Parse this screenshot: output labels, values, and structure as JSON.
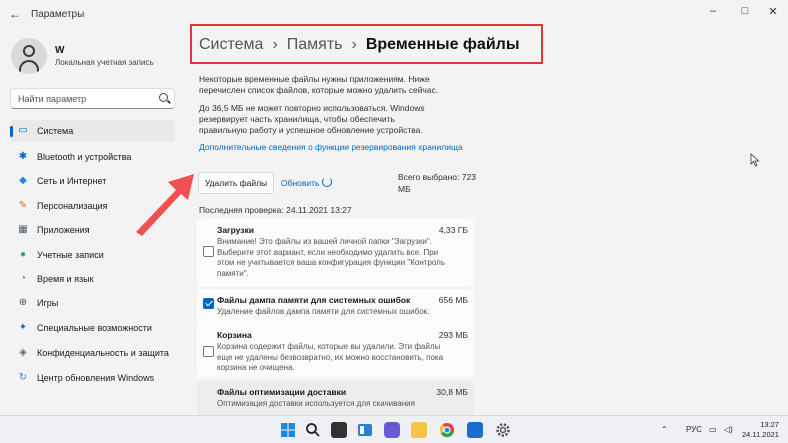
{
  "window": {
    "title": "Параметры",
    "back_icon": "←",
    "min_icon": "–",
    "max_icon": "□",
    "close_icon": "✕"
  },
  "user": {
    "name": "W",
    "account_type": "Локальная учетная запись"
  },
  "search": {
    "placeholder": "Найти параметр"
  },
  "sidebar": {
    "items": [
      {
        "label": "Система",
        "icon": "monitor-icon",
        "glyph": "▭",
        "color": "#0067c0",
        "active": true
      },
      {
        "label": "Bluetooth и устройства",
        "icon": "bluetooth-icon",
        "glyph": "✱",
        "color": "#0067c0"
      },
      {
        "label": "Сеть и Интернет",
        "icon": "wifi-icon",
        "glyph": "◆",
        "color": "#1e88e5"
      },
      {
        "label": "Персонализация",
        "icon": "brush-icon",
        "glyph": "✎",
        "color": "#c9743a"
      },
      {
        "label": "Приложения",
        "icon": "apps-icon",
        "glyph": "▦",
        "color": "#4a5a6a"
      },
      {
        "label": "Учетные записи",
        "icon": "accounts-icon",
        "glyph": "●",
        "color": "#2aa0a0"
      },
      {
        "label": "Время и язык",
        "icon": "globe-icon",
        "glyph": "◔",
        "color": "#1e88e5"
      },
      {
        "label": "Игры",
        "icon": "gamepad-icon",
        "glyph": "⊕",
        "color": "#555"
      },
      {
        "label": "Специальные возможности",
        "icon": "accessibility-icon",
        "glyph": "✦",
        "color": "#1e6fb8"
      },
      {
        "label": "Конфиденциальность и защита",
        "icon": "shield-icon",
        "glyph": "◈",
        "color": "#666"
      },
      {
        "label": "Центр обновления Windows",
        "icon": "update-icon",
        "glyph": "↻",
        "color": "#1e88e5"
      }
    ]
  },
  "breadcrumb": {
    "part1": "Система",
    "part2": "Память",
    "part3": "Временные файлы",
    "sep": "›",
    "highlight_color": "#e0363a"
  },
  "main": {
    "intro": "Некоторые временные файлы нужны приложениям. Ниже перечислен список файлов, которые можно удалить сейчас.",
    "reserve": "До 36,5 МБ не может повторно использоваться. Windows резервирует часть хранилища, чтобы обеспечить правильную работу и успешное обновление устройства.",
    "reserve_link": "Дополнительные сведения о функции резервирования хранилища",
    "delete_button": "Удалить файлы",
    "refresh_link": "Обновить",
    "total_selected": "Всего выбрано: 723 МБ",
    "last_scan": "Последняя проверка: 24.11.2021 13:27",
    "accent": "#0067c0"
  },
  "files": [
    {
      "title": "Загрузки",
      "size": "4,33 ГБ",
      "checked": false,
      "desc": "Внимание! Это файлы из вашей личной папки \"Загрузки\". Выберите этот вариант, если необходимо удалить все. При этом не учитывается ваша конфигурация функции \"Контроль памяти\"."
    },
    {
      "title": "Файлы дампа памяти для системных ошибок",
      "size": "656 МБ",
      "checked": true,
      "desc": "Удаление файлов дампа памяти для системных ошибок."
    },
    {
      "title": "Корзина",
      "size": "293 МБ",
      "checked": false,
      "desc": "Корзина содержит файлы, которые вы удалили. Эти файлы еще не удалены безвозвратно, их можно восстановить, пока корзина не очищена."
    },
    {
      "title": "Файлы оптимизации доставки",
      "size": "30,8 МБ",
      "checked": true,
      "desc": "Оптимизация доставки используется для скачивания"
    }
  ],
  "taskbar": {
    "lang": "РУС",
    "time": "13:27",
    "date": "24.11.2021"
  }
}
